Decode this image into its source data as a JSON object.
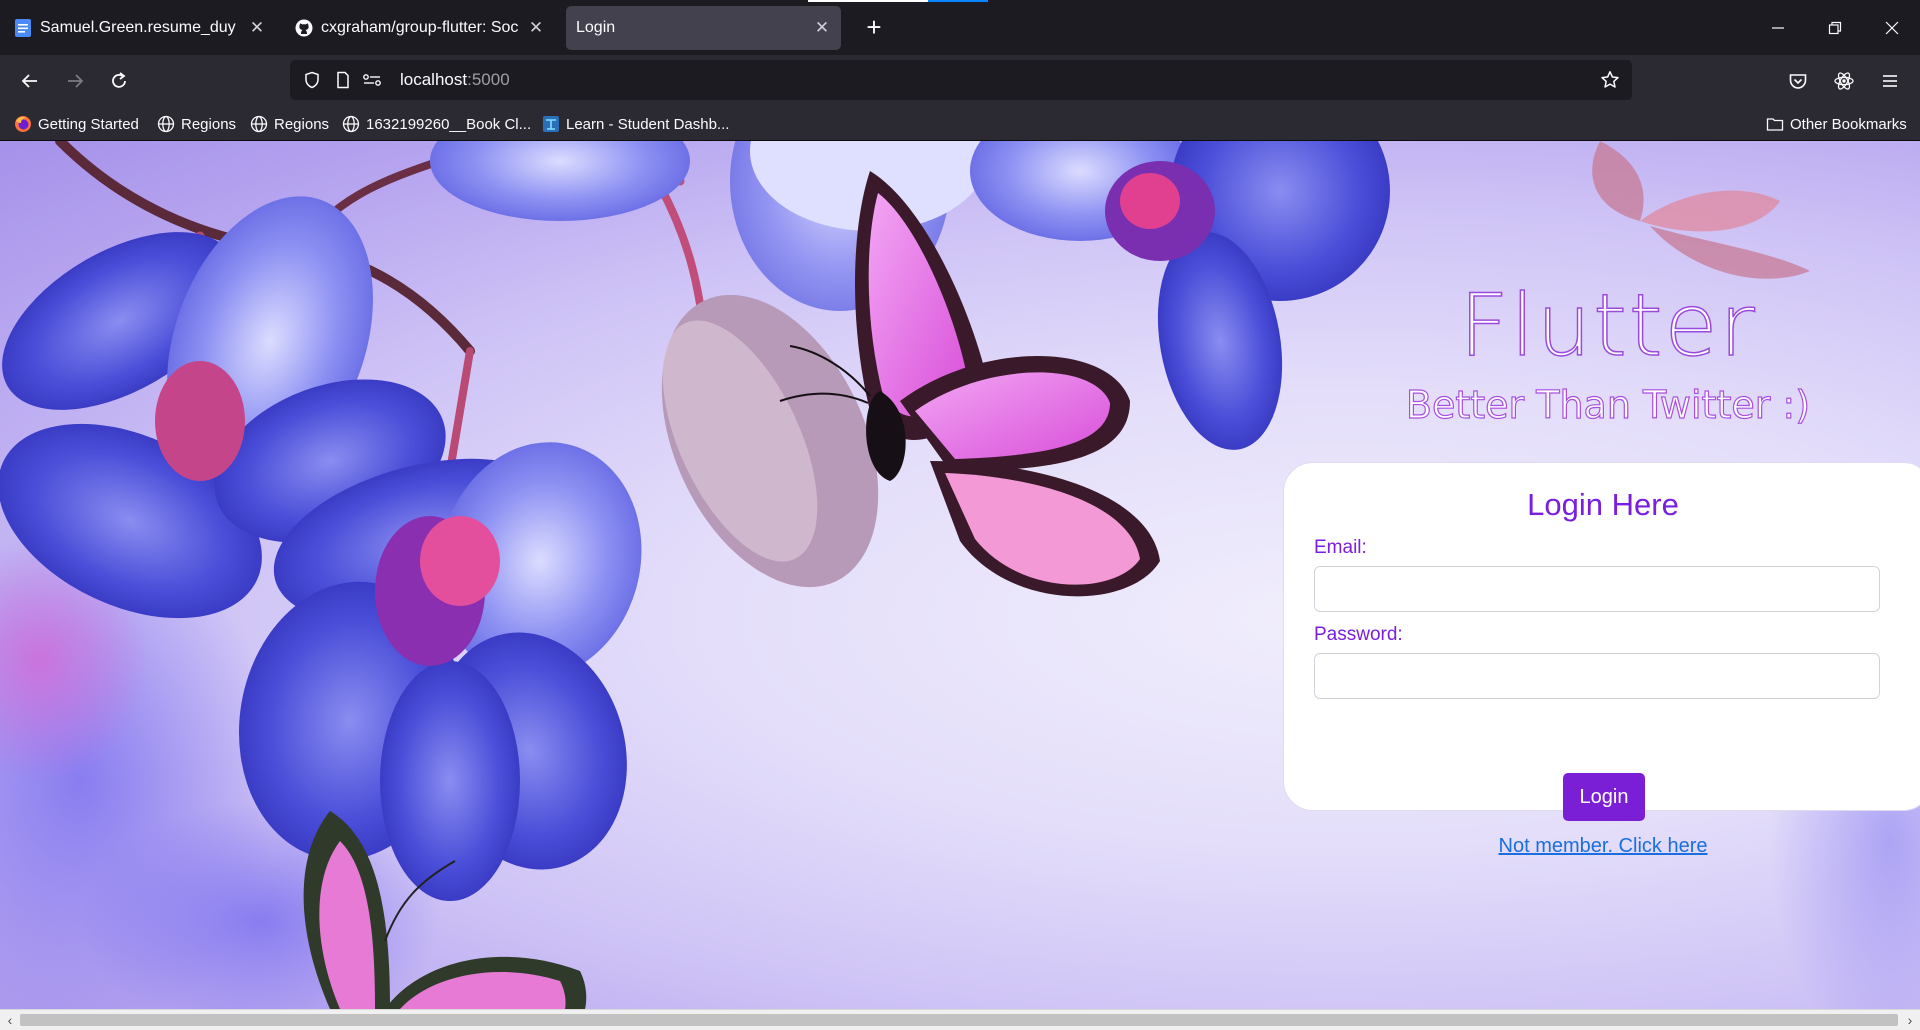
{
  "tabs": [
    {
      "title": "Samuel.Green.resume_duy edits",
      "icon": "docs-icon",
      "active": false
    },
    {
      "title": "cxgraham/group-flutter: Social",
      "icon": "github-icon",
      "active": false
    },
    {
      "title": "Login",
      "icon": "",
      "active": true
    }
  ],
  "address": {
    "host": "localhost",
    "port": ":5000"
  },
  "bookmarks": [
    {
      "label": "Getting Started",
      "icon": "firefox-icon"
    },
    {
      "label": "Regions",
      "icon": "globe-icon"
    },
    {
      "label": "Regions",
      "icon": "globe-icon"
    },
    {
      "label": "1632199260__Book Cl...",
      "icon": "globe-icon"
    },
    {
      "label": "Learn - Student Dashb...",
      "icon": "learn-icon"
    }
  ],
  "other_bookmarks": "Other Bookmarks",
  "page": {
    "brand": "Flutter",
    "tagline": "Better Than Twitter :)",
    "form": {
      "title": "Login Here",
      "email_label": "Email:",
      "email_value": "",
      "password_label": "Password:",
      "password_value": "",
      "submit_label": "Login",
      "register_link": "Not member. Click here"
    }
  },
  "colors": {
    "accent": "#7b1fd6",
    "link": "#1a6fe0",
    "chrome_dark": "#1c1b22",
    "chrome": "#2b2a33"
  }
}
